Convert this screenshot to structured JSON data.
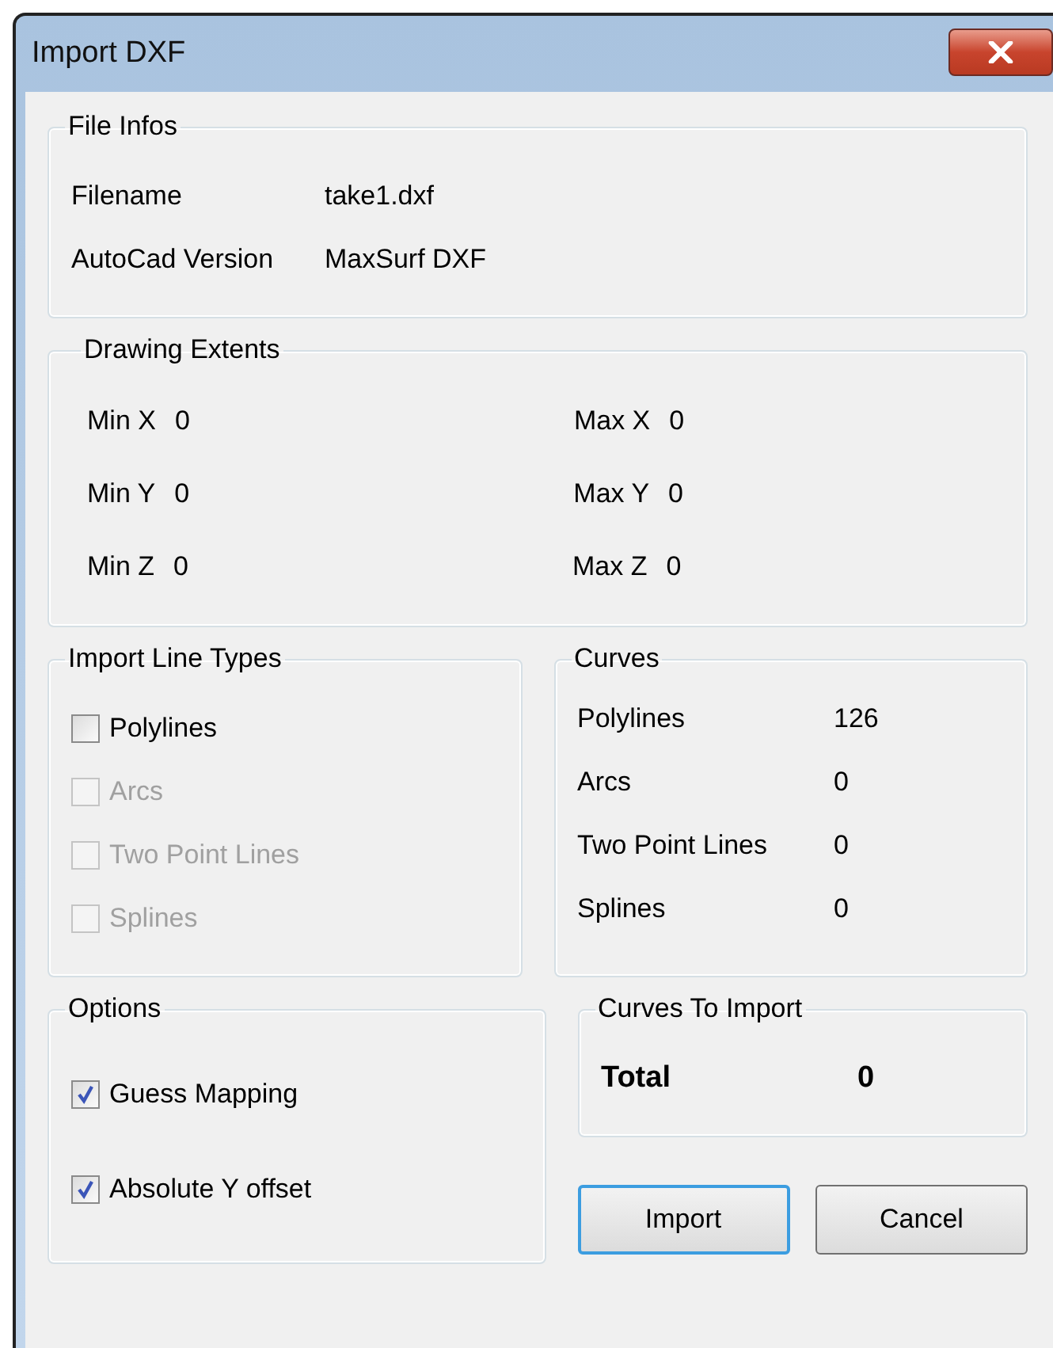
{
  "window": {
    "title": "Import DXF"
  },
  "file_infos": {
    "title": "File Infos",
    "rows": [
      {
        "label": "Filename",
        "value": "take1.dxf"
      },
      {
        "label": "AutoCad Version",
        "value": "MaxSurf DXF"
      }
    ]
  },
  "drawing_extents": {
    "title": "Drawing Extents",
    "rows": [
      {
        "min_label": "Min X",
        "min_value": "0",
        "max_label": "Max X",
        "max_value": "0"
      },
      {
        "min_label": "Min Y",
        "min_value": "0",
        "max_label": "Max Y",
        "max_value": "0"
      },
      {
        "min_label": "Min Z",
        "min_value": "0",
        "max_label": "Max Z",
        "max_value": "0"
      }
    ]
  },
  "import_line_types": {
    "title": "Import Line Types",
    "items": [
      {
        "label": "Polylines",
        "checked": false,
        "disabled": false
      },
      {
        "label": "Arcs",
        "checked": false,
        "disabled": true
      },
      {
        "label": "Two Point Lines",
        "checked": false,
        "disabled": true
      },
      {
        "label": "Splines",
        "checked": false,
        "disabled": true
      }
    ]
  },
  "curves": {
    "title": "Curves",
    "rows": [
      {
        "label": "Polylines",
        "value": "126"
      },
      {
        "label": "Arcs",
        "value": "0"
      },
      {
        "label": "Two Point Lines",
        "value": "0"
      },
      {
        "label": "Splines",
        "value": "0"
      }
    ]
  },
  "options": {
    "title": "Options",
    "items": [
      {
        "label": "Guess Mapping",
        "checked": true
      },
      {
        "label": "Absolute Y offset",
        "checked": true
      }
    ]
  },
  "curves_to_import": {
    "title": "Curves To Import",
    "label": "Total",
    "value": "0"
  },
  "buttons": [
    {
      "label": "Import",
      "default": true
    },
    {
      "label": "Cancel",
      "default": false
    }
  ]
}
